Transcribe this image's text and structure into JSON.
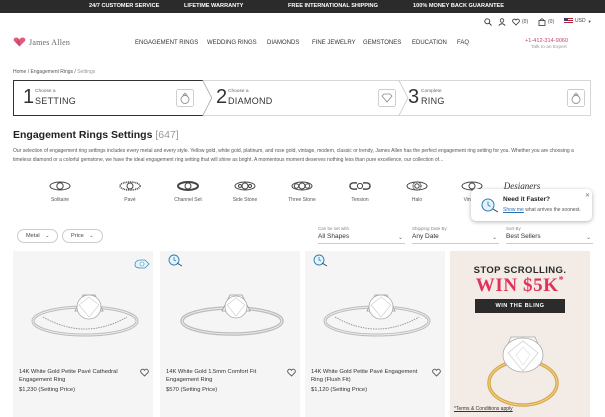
{
  "topbar": {
    "items": [
      "24/7 CUSTOMER SERVICE",
      "LIFETIME WARRANTY",
      "FREE INTERNATIONAL SHIPPING",
      "100% MONEY BACK GUARANTEE"
    ]
  },
  "header": {
    "logo_text": "James Allen",
    "nav": [
      "ENGAGEMENT RINGS",
      "WEDDING RINGS",
      "DIAMONDS",
      "FINE JEWELRY",
      "GEMSTONES",
      "EDUCATION",
      "FAQ"
    ],
    "wishlist_count": "(0)",
    "cart_count": "(0)",
    "currency": "USD",
    "phone": "+1-412-314-9060",
    "chat": "Talk to an Expert"
  },
  "breadcrumb": {
    "home": "Home",
    "sep": " / ",
    "section": "Engagement Rings",
    "current": "Settings"
  },
  "steps": [
    {
      "num": "1",
      "small": "Choose a",
      "big": "SETTING",
      "icon": "ring-icon"
    },
    {
      "num": "2",
      "small": "Choose a",
      "big": "DIAMOND",
      "icon": "diamond-icon"
    },
    {
      "num": "3",
      "small": "Complete",
      "big": "RING",
      "icon": "ring-icon"
    }
  ],
  "page": {
    "title": "Engagement Rings Settings",
    "count": "[647]",
    "description": "Our selection of engagement ring settings includes every metal and every style. Yellow gold, white gold, platinum, and rose gold, vintage, modern, classic or trendy, James Allen has the perfect engagement ring setting for you. Whether you are choosing a timeless diamond or a colorful gemstone, we have the ideal engagement ring setting that will shine as bright. A momentous moment deserves nothing less than pure excellence, our collection of..."
  },
  "ring_styles": [
    "Solitaire",
    "Pavé",
    "Channel Set",
    "Side Stone",
    "Three Stone",
    "Tension",
    "Halo",
    "Vintage",
    "Designers"
  ],
  "filters": {
    "metal": "Metal",
    "price": "Price",
    "shapes_label": "Can be set with",
    "shapes_value": "All Shapes",
    "date_label": "Shipping Date By",
    "date_value": "Any Date",
    "sort_label": "Sort By",
    "sort_value": "Best Sellers"
  },
  "products": [
    {
      "name": "14K White Gold Petite Pavé Cathedral Engagement Ring",
      "price": "$1,230 (Setting Price)"
    },
    {
      "name": "14K White Gold 1.5mm Comfort Fit Engagement Ring",
      "price": "$570 (Setting Price)"
    },
    {
      "name": "14K White Gold Petite Pavé Engagement Ring (Flush Fit)",
      "price": "$1,120 (Setting Price)"
    }
  ],
  "ad": {
    "line1": "STOP SCROLLING.",
    "line2": "WIN $5K",
    "line2_mark": "*",
    "button": "WIN THE BLING",
    "terms": "*Terms & Conditions apply"
  },
  "popup": {
    "title": "Need it Faster?",
    "link": "Show me",
    "text": " what arrives the soonest."
  },
  "colors": {
    "brand_pink": "#c1466b",
    "ad_red": "#e0325a",
    "topbar": "#2b2b2b"
  }
}
